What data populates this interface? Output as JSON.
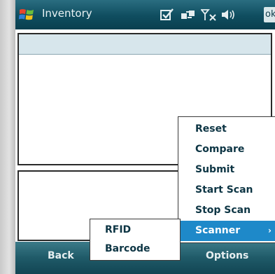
{
  "titlebar": {
    "title": "Inventory",
    "ok_label": "ok"
  },
  "menu": {
    "items": [
      {
        "label": "Reset"
      },
      {
        "label": "Compare"
      },
      {
        "label": "Submit"
      },
      {
        "label": "Start Scan"
      },
      {
        "label": "Stop Scan"
      },
      {
        "label": "Scanner",
        "selected": true
      }
    ],
    "submenu_arrow": "›"
  },
  "submenu": {
    "items": [
      {
        "label": "RFID"
      },
      {
        "label": "Barcode"
      }
    ]
  },
  "softkeys": {
    "left": "Back",
    "right": "Options"
  },
  "icons": {
    "start": "windows-start-icon",
    "notify": "notification-checkbox-icon",
    "connectivity": "connectivity-icon",
    "signal": "signal-off-icon",
    "volume": "volume-icon"
  },
  "colors": {
    "titlebar": "#0f4d5f",
    "selected_item": "#1e89c9",
    "panel_header": "#d7e6ec"
  }
}
